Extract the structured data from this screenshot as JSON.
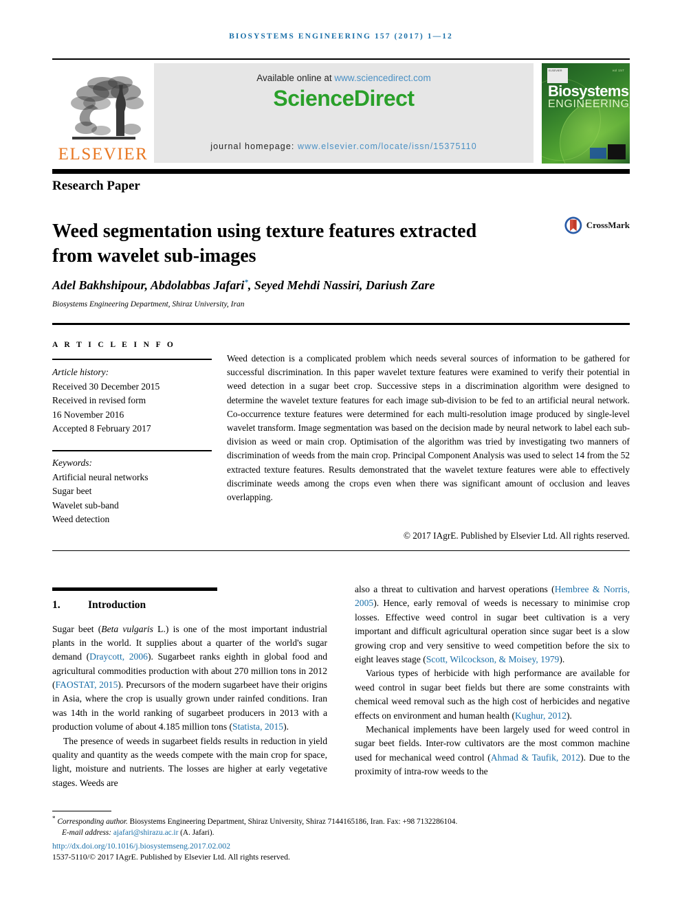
{
  "running_head": "Biosystems Engineering 157 (2017) 1—12",
  "masthead": {
    "available_online_prefix": "Available online at ",
    "sciencedirect_url": "www.sciencedirect.com",
    "sciencedirect_wordmark": "ScienceDirect",
    "journal_homepage_prefix": "journal homepage: ",
    "journal_homepage_url": "www.elsevier.com/locate/issn/15375110",
    "elsevier_wordmark": "ELSEVIER",
    "cover": {
      "title_line1": "Biosystems",
      "title_line2": "ENGINEERING",
      "volume_text": "vol 157",
      "publisher_mark": "ELSEVIER"
    }
  },
  "article": {
    "section_label": "Research Paper",
    "title": "Weed segmentation using texture features extracted from wavelet sub-images",
    "crossmark_label": "CrossMark",
    "authors_plain": "Adel Bakhshipour, Abdolabbas Jafari",
    "authors_rest": ", Seyed Mehdi Nassiri, Dariush Zare",
    "corresponding_marker": "*",
    "affiliation": "Biosystems Engineering Department, Shiraz University, Iran"
  },
  "article_info": {
    "heading": "A R T I C L E   I N F O",
    "history_label": "Article history:",
    "history": [
      "Received 30 December 2015",
      "Received in revised form",
      "16 November 2016",
      "Accepted 8 February 2017"
    ],
    "keywords_label": "Keywords:",
    "keywords": [
      "Artificial neural networks",
      "Sugar beet",
      "Wavelet sub-band",
      "Weed detection"
    ]
  },
  "abstract": {
    "text": "Weed detection is a complicated problem which needs several sources of information to be gathered for successful discrimination. In this paper wavelet texture features were examined to verify their potential in weed detection in a sugar beet crop. Successive steps in a discrimination algorithm were designed to determine the wavelet texture features for each image sub-division to be fed to an artificial neural network. Co-occurrence texture features were determined for each multi-resolution image produced by single-level wavelet transform. Image segmentation was based on the decision made by neural network to label each sub-division as weed or main crop. Optimisation of the algorithm was tried by investigating two manners of discrimination of weeds from the main crop. Principal Component Analysis was used to select 14 from the 52 extracted texture features. Results demonstrated that the wavelet texture features were able to effectively discriminate weeds among the crops even when there was significant amount of occlusion and leaves overlapping.",
    "copyright": "© 2017 IAgrE. Published by Elsevier Ltd. All rights reserved."
  },
  "introduction": {
    "number": "1.",
    "heading": "Introduction",
    "left_paragraphs": [
      {
        "parts": [
          {
            "t": "Sugar beet (",
            "style": "plain"
          },
          {
            "t": "Beta vulgaris",
            "style": "italic"
          },
          {
            "t": " L.) is one of the most important industrial plants in the world. It supplies about a quarter of the world's sugar demand (",
            "style": "plain"
          },
          {
            "t": "Draycott, 2006",
            "style": "cite"
          },
          {
            "t": "). Sugarbeet ranks eighth in global food and agricultural commodities production with about 270 million tons in 2012 (",
            "style": "plain"
          },
          {
            "t": "FAOSTAT, 2015",
            "style": "cite"
          },
          {
            "t": "). Precursors of the modern sugarbeet have their origins in Asia, where the crop is usually grown under rainfed conditions. Iran was 14th in the world ranking of sugarbeet producers in 2013 with a production volume of about 4.185 million tons (",
            "style": "plain"
          },
          {
            "t": "Statista, 2015",
            "style": "cite"
          },
          {
            "t": ").",
            "style": "plain"
          }
        ]
      },
      {
        "parts": [
          {
            "t": "The presence of weeds in sugarbeet fields results in reduction in yield quality and quantity as the weeds compete with the main crop for space, light, moisture and nutrients. The losses are higher at early vegetative stages. Weeds are",
            "style": "plain"
          }
        ]
      }
    ],
    "right_paragraphs": [
      {
        "parts": [
          {
            "t": "also a threat to cultivation and harvest operations (",
            "style": "plain"
          },
          {
            "t": "Hembree & Norris, 2005",
            "style": "cite"
          },
          {
            "t": "). Hence, early removal of weeds is necessary to minimise crop losses. Effective weed control in sugar beet cultivation is a very important and difficult agricultural operation since sugar beet is a slow growing crop and very sensitive to weed competition before the six to eight leaves stage (",
            "style": "plain"
          },
          {
            "t": "Scott, Wilcockson, & Moisey, 1979",
            "style": "cite"
          },
          {
            "t": ").",
            "style": "plain"
          }
        ]
      },
      {
        "parts": [
          {
            "t": "Various types of herbicide with high performance are available for weed control in sugar beet fields but there are some constraints with chemical weed removal such as the high cost of herbicides and negative effects on environment and human health (",
            "style": "plain"
          },
          {
            "t": "Kughur, 2012",
            "style": "cite"
          },
          {
            "t": ").",
            "style": "plain"
          }
        ]
      },
      {
        "parts": [
          {
            "t": "Mechanical implements have been largely used for weed control in sugar beet fields. Inter-row cultivators are the most common machine used for mechanical weed control (",
            "style": "plain"
          },
          {
            "t": "Ahmad & Taufik, 2012",
            "style": "cite"
          },
          {
            "t": "). Due to the proximity of intra-row weeds to the",
            "style": "plain"
          }
        ]
      }
    ]
  },
  "footer": {
    "corresponding_italic": "Corresponding author.",
    "corresponding_rest": " Biosystems Engineering Department, Shiraz University, Shiraz 7144165186, Iran. Fax: +98 7132286104.",
    "email_label": "E-mail address: ",
    "email": "ajafari@shirazu.ac.ir",
    "email_suffix": " (A. Jafari).",
    "doi": "http://dx.doi.org/10.1016/j.biosystemseng.2017.02.002",
    "issn_line": "1537-5110/© 2017 IAgrE. Published by Elsevier Ltd. All rights reserved."
  },
  "colors": {
    "link_blue": "#1a6fa8",
    "elsevier_orange": "#e87722",
    "sciencedirect_green": "#2aa02a",
    "cover_green": "#2f7a2a"
  }
}
